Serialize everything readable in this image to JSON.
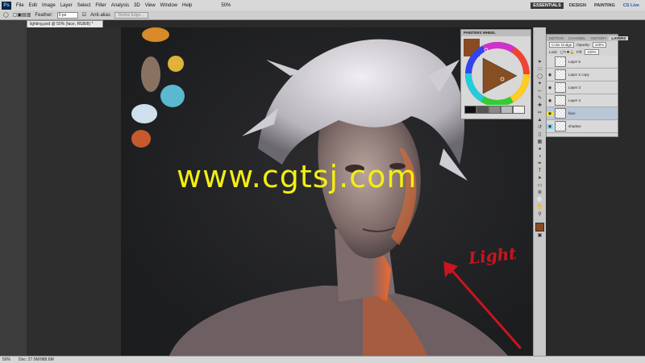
{
  "app": {
    "logo": "Ps"
  },
  "menus": [
    "File",
    "Edit",
    "Image",
    "Layer",
    "Select",
    "Filter",
    "Analysis",
    "3D",
    "View",
    "Window",
    "Help"
  ],
  "zoom_menu": "50%",
  "workspace": {
    "buttons": [
      "ESSENTIALS",
      "DESIGN",
      "PAINTING"
    ],
    "active": "ESSENTIALS",
    "cslive": "CS Live"
  },
  "options": {
    "feather_label": "Feather:",
    "feather_value": "0 px",
    "antialias": "Anti-alias",
    "refine": "Refine Edge..."
  },
  "document": {
    "tab": "lighting.psd @ 50% (face, RGB/8) *"
  },
  "status": {
    "zoom": "50%",
    "doc": "Doc: 27.0M/988.6M"
  },
  "color_panel": {
    "title": "PAINTERS WHEEL"
  },
  "layers": {
    "tabs": [
      "MOTION",
      "CHANNEL",
      "HISTORY",
      "LAYERS"
    ],
    "blend_mode": "Color Dodge",
    "opacity_label": "Opacity:",
    "opacity": "100%",
    "lock_label": "Lock:",
    "fill_label": "Fill:",
    "fill": "100%",
    "items": [
      {
        "name": "Layer 5"
      },
      {
        "name": "Layer 2 copy"
      },
      {
        "name": "Layer 3"
      },
      {
        "name": "Layer 4"
      },
      {
        "name": "face"
      },
      {
        "name": "shadow"
      }
    ]
  },
  "overlay": {
    "watermark": "www.cgtsj.com",
    "annotation": "Light"
  },
  "colors": {
    "accent": "#c8151e",
    "watermark": "#f3ee12"
  }
}
